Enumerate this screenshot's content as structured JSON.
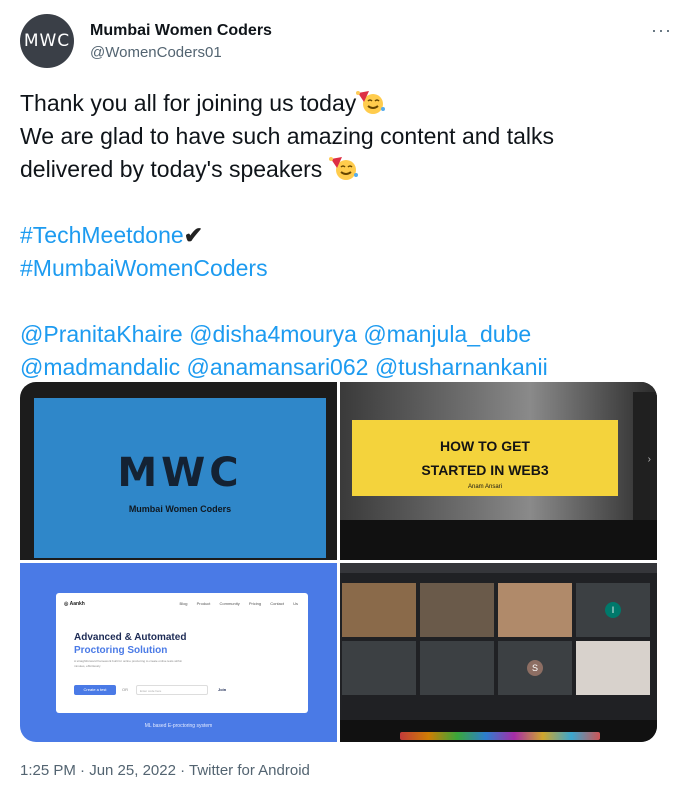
{
  "author": {
    "avatar_text": "MWC",
    "name": "Mumbai Women Coders",
    "handle": "@WomenCoders01"
  },
  "menu": {
    "more_label": "···"
  },
  "tweet": {
    "line1": "Thank you all for joining us today",
    "line2": "We are glad to have such amazing content and talks",
    "line3": "delivered by today's speakers",
    "hashtag1": "#TechMeetdone",
    "hashtag1_suffix": "✔",
    "hashtag2": "#MumbaiWomenCoders",
    "mentions": [
      "@PranitaKhaire",
      "@disha4mourya",
      "@manjula_dube",
      "@madmandalic",
      "@anamansari062",
      "@tusharnankanii"
    ],
    "emoji_1": "partying-face-emoji",
    "emoji_2": "partying-face-emoji"
  },
  "media": {
    "slide1": {
      "logo": "MWC",
      "subtitle": "Mumbai Women Coders"
    },
    "slide2": {
      "title_line1": "HOW TO GET",
      "title_line2": "STARTED IN WEB3",
      "speaker": "Anam Ansari"
    },
    "slide3": {
      "brand": "Aankh",
      "nav": "Blog Product Community Pricing Contact Us",
      "headline1": "Advanced & Automated",
      "headline2": "Proctoring Solution",
      "desc": "A straightforward framework built for online proctoring to create online tests within minutes, effortlessly",
      "button": "Create a test",
      "or": "OR",
      "input_placeholder": "Enter code here",
      "join": "Join",
      "footer": "ML based E-proctoring system"
    },
    "slide4": {
      "avatar1": "I",
      "avatar2": "S"
    }
  },
  "footer": {
    "timestamp": "1:25 PM · Jun 25, 2022 · Twitter for Android"
  }
}
